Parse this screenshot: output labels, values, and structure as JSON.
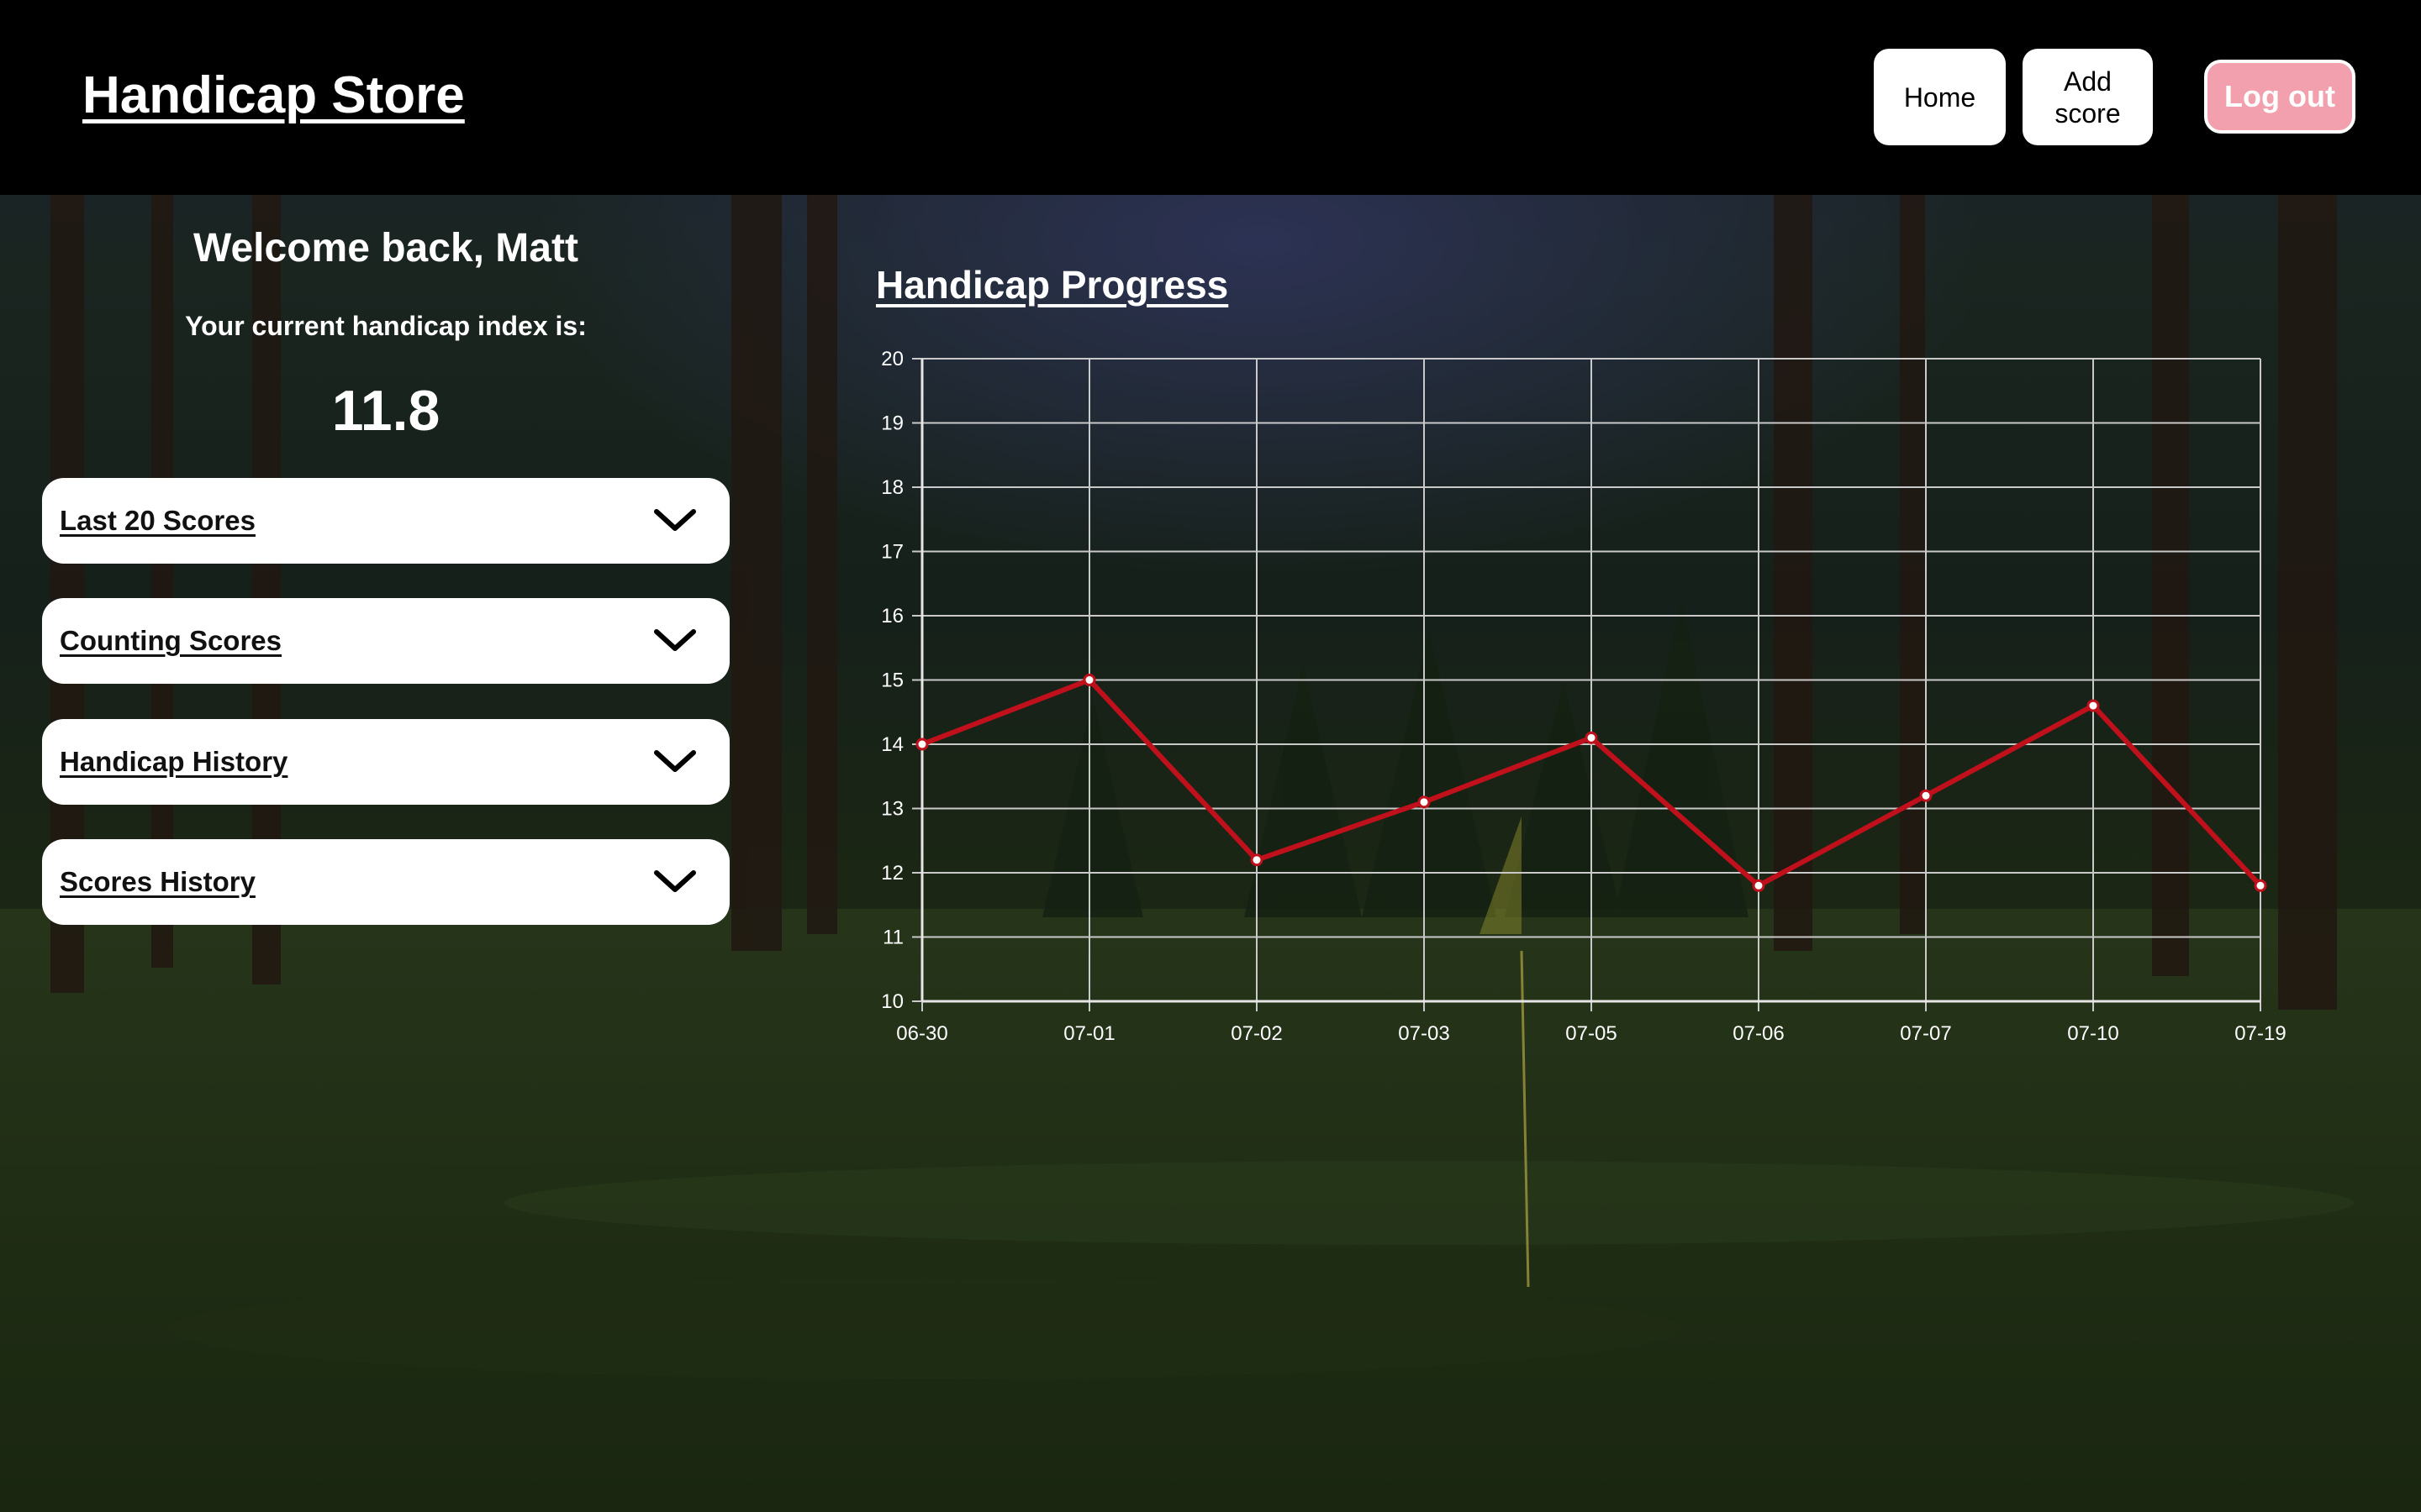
{
  "header": {
    "brand": "Handicap Store",
    "nav": {
      "home_label": "Home",
      "add_score_label": "Add\nscore",
      "logout_label": "Log out"
    }
  },
  "summary": {
    "welcome": "Welcome back, Matt",
    "index_label": "Your current handicap index is:",
    "index_value": "11.8"
  },
  "sections": [
    {
      "label": "Last 20 Scores",
      "icon": "chevron-down-icon"
    },
    {
      "label": "Counting Scores",
      "icon": "chevron-down-icon"
    },
    {
      "label": "Handicap History",
      "icon": "chevron-down-icon"
    },
    {
      "label": "Scores History",
      "icon": "chevron-down-icon"
    }
  ],
  "colors": {
    "header_bg": "#000000",
    "logout_bg": "#f2a0ad",
    "line": "#c0101c",
    "grid": "#c9c9c9"
  },
  "chart_data": {
    "type": "line",
    "title": "Handicap Progress",
    "categories": [
      "06-30",
      "07-01",
      "07-02",
      "07-03",
      "07-05",
      "07-06",
      "07-07",
      "07-10",
      "07-19"
    ],
    "series": [
      {
        "values": [
          14.0,
          15.0,
          12.2,
          13.1,
          14.1,
          11.8,
          13.2,
          14.6,
          11.8
        ]
      }
    ],
    "ylim": [
      10,
      20
    ],
    "yticks": [
      10,
      11,
      12,
      13,
      14,
      15,
      16,
      17,
      18,
      19,
      20
    ],
    "grid": true,
    "legend": "none"
  }
}
